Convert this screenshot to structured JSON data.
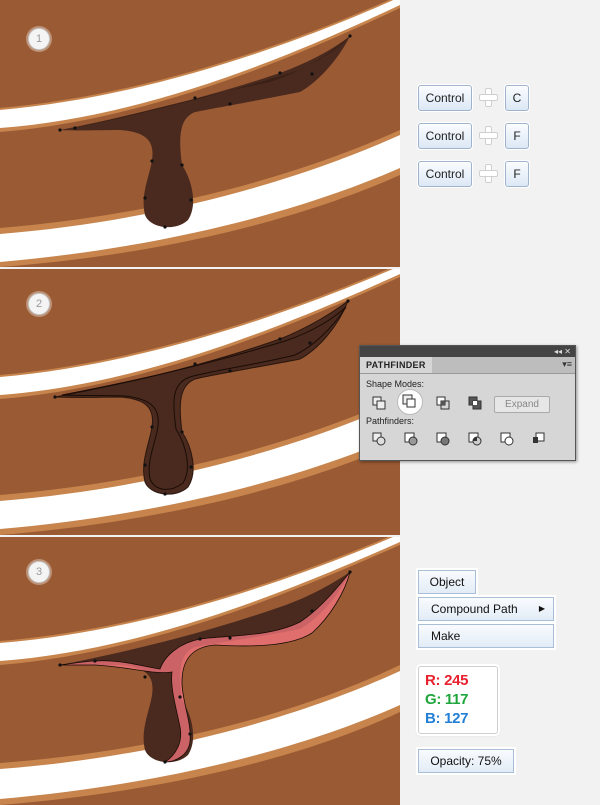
{
  "steps": [
    "1",
    "2",
    "3"
  ],
  "shortcuts": [
    {
      "modifier": "Control",
      "key": "C"
    },
    {
      "modifier": "Control",
      "key": "F"
    },
    {
      "modifier": "Control",
      "key": "F"
    }
  ],
  "pathfinder": {
    "title": "PATHFINDER",
    "top_controls": "◂◂ ✕",
    "menu_icon": "▾≡",
    "shape_modes_label": "Shape Modes:",
    "pathfinders_label": "Pathfinders:",
    "expand_label": "Expand",
    "shape_mode_icons": [
      "unite-icon",
      "minus-front-icon",
      "intersect-icon",
      "exclude-icon"
    ],
    "pathfinder_icons": [
      "divide-icon",
      "trim-icon",
      "merge-icon",
      "crop-icon",
      "outline-icon",
      "minus-back-icon"
    ]
  },
  "menu": {
    "object_label": "Object",
    "compound_path_label": "Compound Path",
    "make_label": "Make",
    "submenu_arrow": "▶"
  },
  "color": {
    "r_label": "R: 245",
    "g_label": "G: 117",
    "b_label": "B: 127",
    "r_color": "#e8212e",
    "g_color": "#1ea53c",
    "b_color": "#2380d6",
    "fill_color": "#f5757f"
  },
  "opacity_label": "Opacity: 75%",
  "colors": {
    "cake": "#9a5a34",
    "frosting": "#ffffff",
    "crust": "#c7844c",
    "chocolate_dark": "#4a2a1e",
    "chocolate_mid": "#5b3424"
  }
}
